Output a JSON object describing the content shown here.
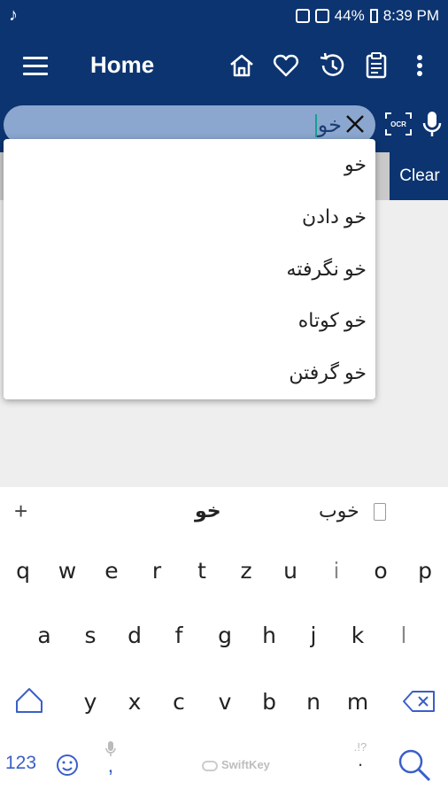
{
  "status_bar": {
    "battery": "44%",
    "time": "8:39 PM"
  },
  "app_bar": {
    "title": "Home",
    "actions": [
      "home-icon",
      "heart-icon",
      "history-icon",
      "clipboard-icon",
      "more-vert-icon"
    ]
  },
  "search": {
    "value": "خو",
    "clear_label": "Clear"
  },
  "suggestions": [
    "خو",
    "خو دادن",
    "خو نگرفته",
    "خو کوتاه",
    "خو گرفتن"
  ],
  "keyboard": {
    "prediction_left": "+",
    "prediction_center": "خو",
    "prediction_right": "خوب",
    "row1": [
      "q",
      "w",
      "e",
      "r",
      "t",
      "z",
      "u",
      "i",
      "o",
      "p"
    ],
    "row2": [
      "a",
      "s",
      "d",
      "f",
      "g",
      "h",
      "j",
      "k",
      "l"
    ],
    "row3": [
      "y",
      "x",
      "c",
      "v",
      "b",
      "n",
      "m"
    ],
    "num_label": "123",
    "brand": "SwiftKey",
    "comma": ",",
    "period": ".",
    "period_alt": ".!?"
  },
  "colors": {
    "app_bar": "#0c3470",
    "search_box": "#8ba7cf",
    "accent": "#3a5fc8"
  }
}
